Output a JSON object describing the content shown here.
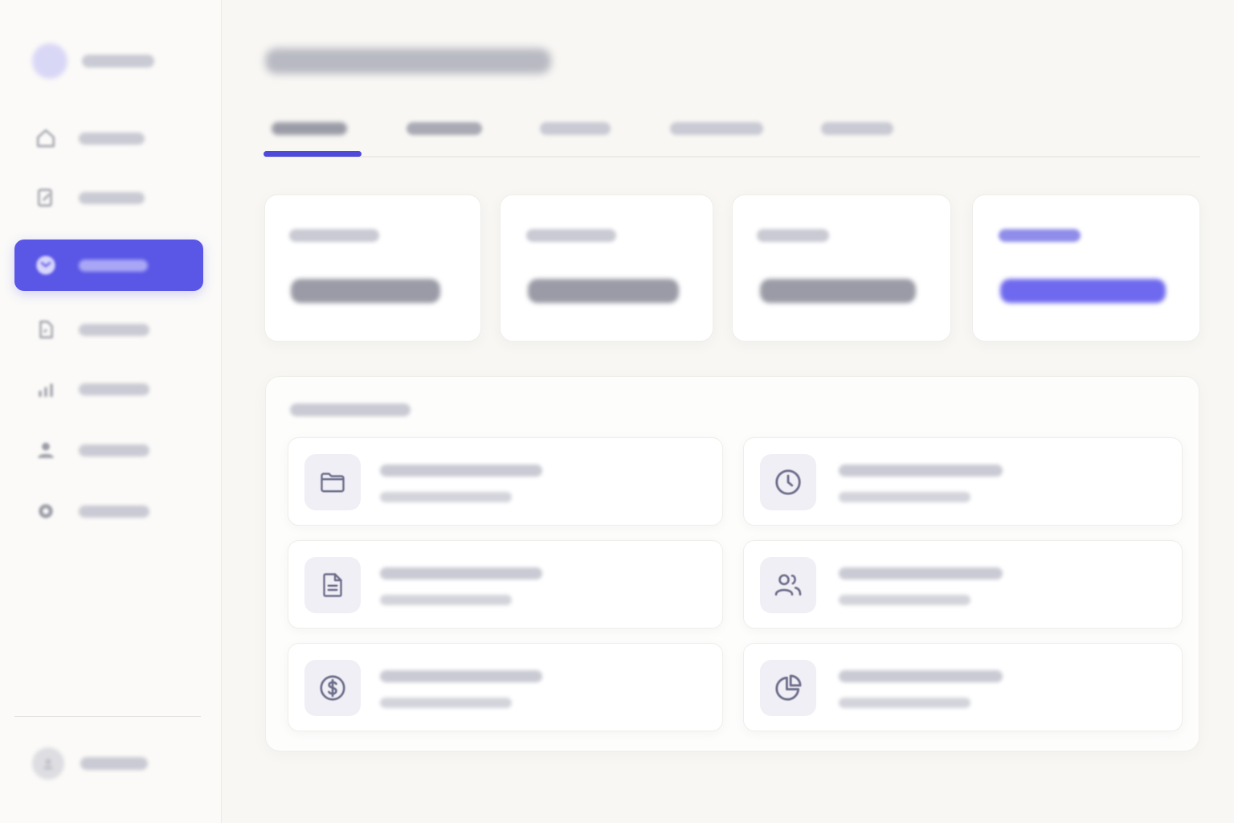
{
  "theme": {
    "accent": "#5a56e6",
    "background": "#f8f7f4",
    "card": "#ffffff",
    "icon_stroke": "#6b6c8a"
  },
  "sidebar": {
    "brand": {
      "logo": "brand-logo"
    },
    "items": [
      {
        "icon": "home-icon",
        "active": false
      },
      {
        "icon": "edit-document-icon",
        "active": false
      },
      {
        "icon": "inbox-icon",
        "active": true
      },
      {
        "icon": "document-icon",
        "active": false
      },
      {
        "icon": "bar-chart-icon",
        "active": false
      },
      {
        "icon": "user-icon",
        "active": false
      },
      {
        "icon": "gear-icon",
        "active": false
      }
    ],
    "user": {
      "icon": "avatar"
    }
  },
  "main": {
    "tabs": [
      {
        "active": true
      },
      {
        "active": false
      },
      {
        "active": false
      },
      {
        "active": false
      },
      {
        "active": false
      }
    ],
    "stat_cards": [
      {
        "highlighted": false
      },
      {
        "highlighted": false
      },
      {
        "highlighted": false
      },
      {
        "highlighted": true
      }
    ],
    "panel": {
      "tiles": [
        {
          "icon": "folder-icon"
        },
        {
          "icon": "clock-icon"
        },
        {
          "icon": "document-icon"
        },
        {
          "icon": "users-icon"
        },
        {
          "icon": "dollar-icon"
        },
        {
          "icon": "pie-chart-icon"
        }
      ]
    }
  }
}
